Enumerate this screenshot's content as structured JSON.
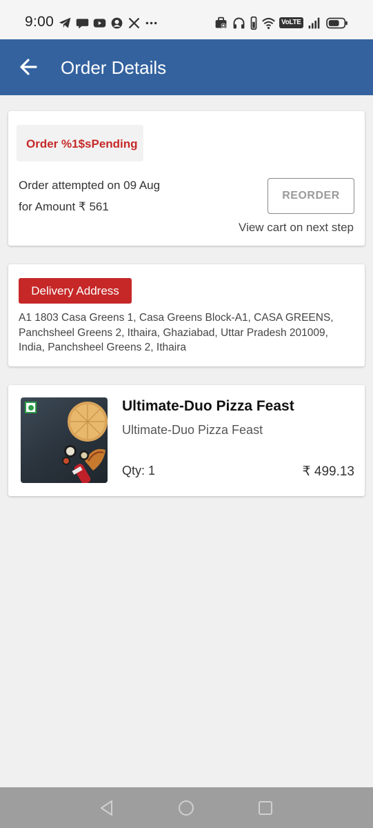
{
  "status_bar": {
    "time": "9:00",
    "left_icons": [
      "telegram-icon",
      "chat-bubble-icon",
      "youtube-icon",
      "app-icon",
      "x-icon",
      "more-dots-icon"
    ],
    "right_icons": [
      "briefcase-icon",
      "headphones-icon",
      "phone-icon",
      "wifi-icon",
      "volte-badge",
      "signal-icon",
      "battery-icon"
    ],
    "volte": "VoLTE"
  },
  "appbar": {
    "title": "Order Details",
    "color": "#33629f"
  },
  "order": {
    "status_label": "Order %1$sPending",
    "attempt_text": "Order attempted on 09 Aug",
    "amount_text": "for Amount ₹ 561",
    "reorder_label": "REORDER",
    "view_cart_text": "View cart on next step"
  },
  "delivery": {
    "label": "Delivery Address",
    "address": "A1 1803 Casa Greens 1, Casa Greens Block-A1, CASA GREENS, Panchsheel Greens 2, Ithaira, Ghaziabad, Uttar Pradesh 201009, India, Panchsheel Greens 2, Ithaira"
  },
  "item": {
    "title": "Ultimate-Duo Pizza Feast",
    "subtitle": "Ultimate-Duo Pizza Feast",
    "qty": "Qty: 1",
    "price": "₹ 499.13",
    "veg": true
  },
  "nav": {
    "buttons": [
      "back-triangle-icon",
      "home-circle-icon",
      "recents-square-icon"
    ]
  },
  "colors": {
    "accent_red": "#c62828",
    "veg_green": "#2e9d4a"
  }
}
